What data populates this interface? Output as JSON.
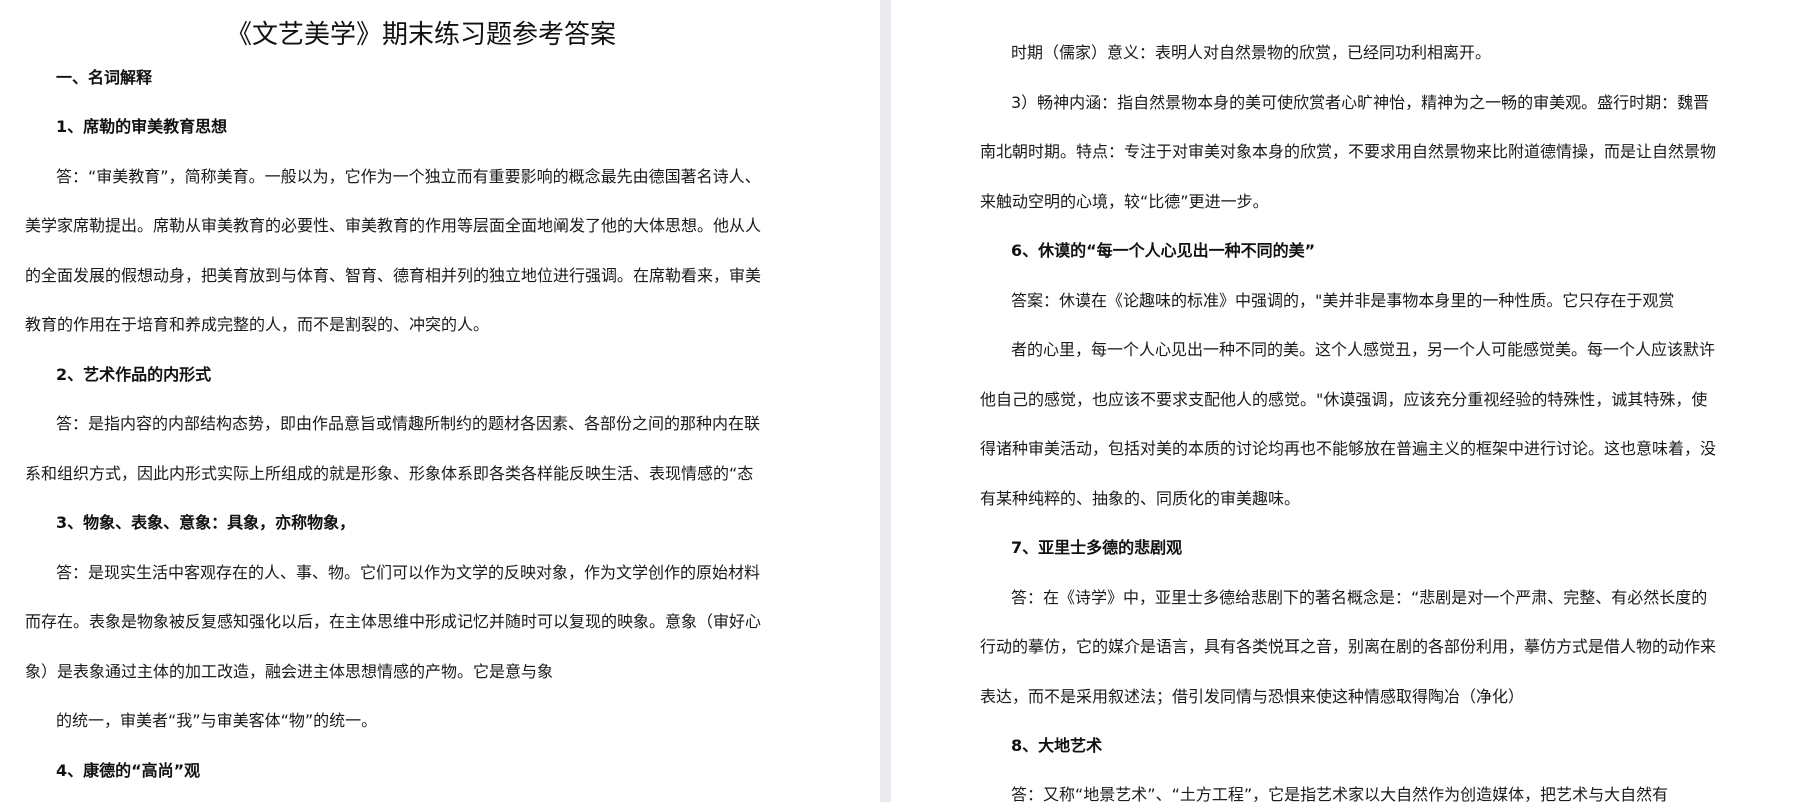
{
  "left_page": {
    "title": "《文艺美学》期末练习题参考答案",
    "section1_heading": "一、名词解释",
    "q1_heading": "1、席勒的审美教育思想",
    "q1_lines": [
      "答：“审美教育”，简称美育。一般以为，它作为一个独立而有重要影响的概念最先由德国著名诗人、",
      "美学家席勒提出。席勒从审美教育的必要性、审美教育的作用等层面全面地阐发了他的大体思想。他从人",
      "的全面发展的假想动身，把美育放到与体育、智育、德育相并列的独立地位进行强调。在席勒看来，审美",
      "教育的作用在于培育和养成完整的人，而不是割裂的、冲突的人。"
    ],
    "q2_heading": "2、艺术作品的内形式",
    "q2_lines": [
      "答：是指内容的内部结构态势，即由作品意旨或情趣所制约的题材各因素、各部份之间的那种内在联",
      "系和组织方式，因此内形式实际上所组成的就是形象、形象体系即各类各样能反映生活、表现情感的“态"
    ],
    "q3_heading": "3、物象、表象、意象：具象，亦称物象，",
    "q3_lines": [
      "答：是现实生活中客观存在的人、事、物。它们可以作为文学的反映对象，作为文学创作的原始材料",
      "而存在。表象是物象被反复感知强化以后，在主体思维中形成记忆并随时可以复现的映象。意象（审好心",
      "象）是表象通过主体的加工改造，融会进主体思想情感的产物。它是意与象",
      "的统一，审美者“我”与审美客体“物”的统一。"
    ],
    "q4_heading": "4、康德的“高尚”观"
  },
  "right_page": {
    "top_lines": [
      "时期（儒家）意义：表明人对自然景物的欣赏，已经同功利相离开。",
      "3）畅神内涵：指自然景物本身的美可使欣赏者心旷神怡，精神为之一畅的审美观。盛行时期：魏晋",
      "南北朝时期。特点：专注于对审美对象本身的欣赏，不要求用自然景物来比附道德情操，而是让自然景物",
      "来触动空明的心境，较“比德”更进一步。"
    ],
    "q6_heading": "6、休谟的“每一个人心见出一种不同的美”",
    "q6_lines": [
      "答案：休谟在《论趣味的标准》中强调的，\"美并非是事物本身里的一种性质。它只存在于观赏",
      "者的心里，每一个人心见出一种不同的美。这个人感觉丑，另一个人可能感觉美。每一个人应该默许",
      "他自己的感觉，也应该不要求支配他人的感觉。\"休谟强调，应该充分重视经验的特殊性，诚其特殊，使",
      "得诸种审美活动，包括对美的本质的讨论均再也不能够放在普遍主义的框架中进行讨论。这也意味着，没",
      "有某种纯粹的、抽象的、同质化的审美趣味。"
    ],
    "q7_heading": "7、亚里士多德的悲剧观",
    "q7_lines": [
      "答：在《诗学》中，亚里士多德给悲剧下的著名概念是：“悲剧是对一个严肃、完整、有必然长度的",
      "行动的摹仿，它的媒介是语言，具有各类悦耳之音，别离在剧的各部份利用，摹仿方式是借人物的动作来",
      "表达，而不是采用叙述法；借引发同情与恐惧来使这种情感取得陶冶（净化）"
    ],
    "q8_heading": "8、大地艺术",
    "q8_lines": [
      "答：又称“地景艺术”、“土方工程”，它是指艺术家以大自然作为创造媒体，把艺术与大自然有"
    ]
  }
}
